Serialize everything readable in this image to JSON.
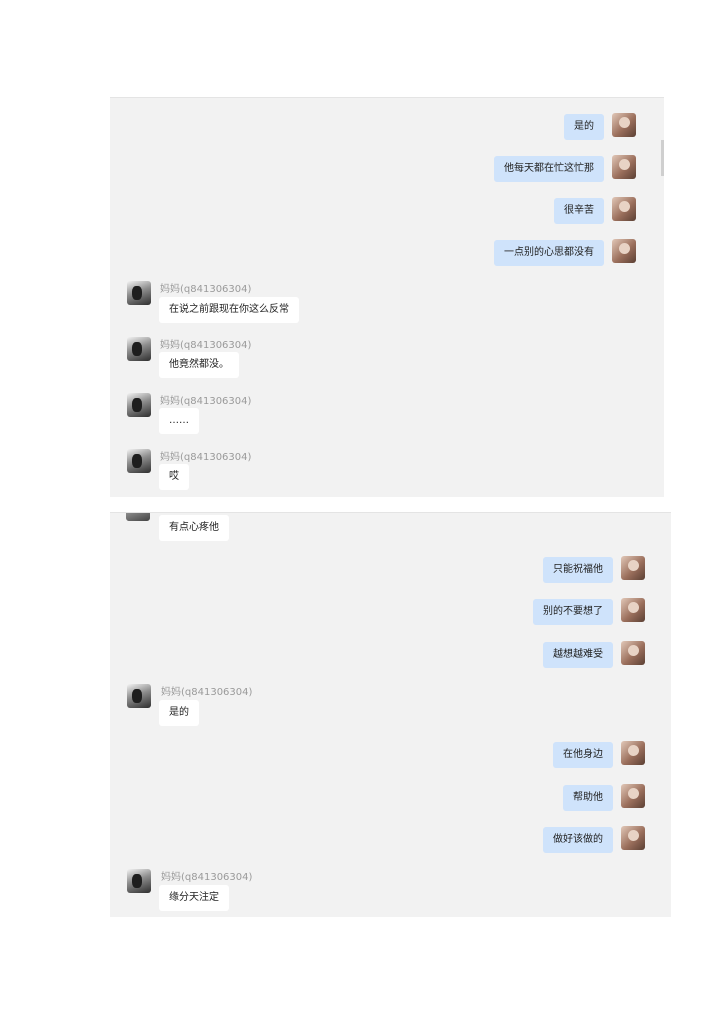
{
  "panel1": {
    "outgoing": [
      {
        "text": "是的",
        "avatar_icon": "self-avatar-icon"
      },
      {
        "text": "他每天都在忙这忙那",
        "avatar_icon": "self-avatar-icon"
      },
      {
        "text": "很辛苦",
        "avatar_icon": "self-avatar-icon"
      },
      {
        "text": "一点别的心思都没有",
        "avatar_icon": "self-avatar-icon"
      }
    ],
    "incoming": [
      {
        "sender": "妈妈(q841306304)",
        "text": "在说之前跟现在你这么反常"
      },
      {
        "sender": "妈妈(q841306304)",
        "text": "他竟然都没。"
      },
      {
        "sender": "妈妈(q841306304)",
        "text": "……"
      },
      {
        "sender": "妈妈(q841306304)",
        "text": "哎"
      }
    ]
  },
  "panel2": {
    "partial_incoming": {
      "text": "有点心疼他"
    },
    "outgoing_group1": [
      {
        "text": "只能祝福他"
      },
      {
        "text": "别的不要想了"
      },
      {
        "text": "越想越难受"
      }
    ],
    "incoming1": {
      "sender": "妈妈(q841306304)",
      "text": "是的"
    },
    "outgoing_group2": [
      {
        "text": "在他身边"
      },
      {
        "text": "帮助他"
      },
      {
        "text": "做好该做的"
      }
    ],
    "incoming2": {
      "sender": "妈妈(q841306304)",
      "text": "缘分天注定"
    }
  },
  "colors": {
    "panel_bg": "#f2f2f2",
    "outgoing_bubble": "#cfe3fb",
    "incoming_bubble": "#ffffff",
    "sender_text": "#9a9a9a"
  }
}
